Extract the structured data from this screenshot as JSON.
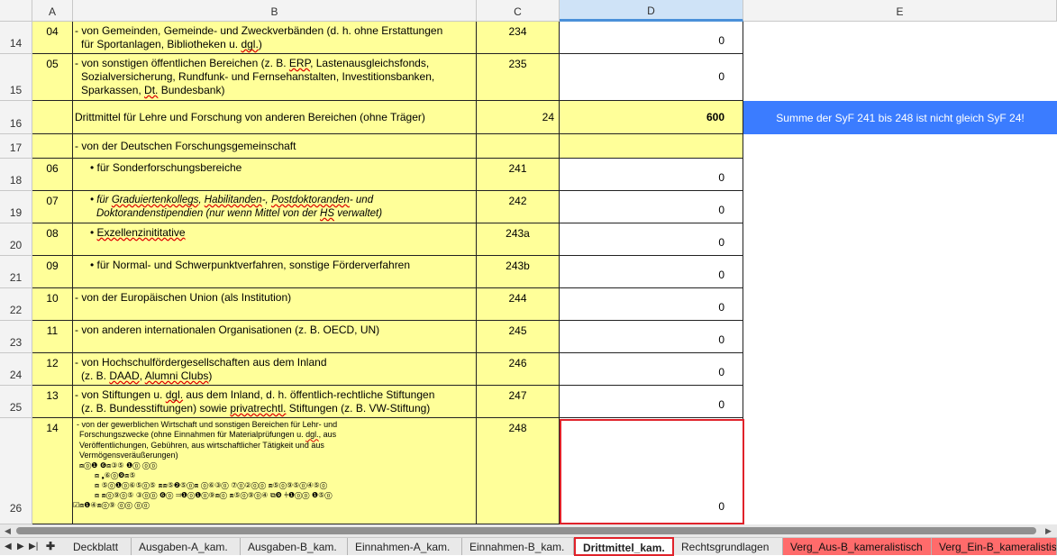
{
  "columns": [
    "A",
    "B",
    "C",
    "D",
    "E"
  ],
  "rows": {
    "r14": {
      "num": "14",
      "a": "04",
      "b1": "- von Gemeinden, Gemeinde- und Zweckverbänden (d. h. ohne Erstattungen",
      "b2": "für Sportanlagen, Bibliotheken u. ",
      "b2w": "dgl.",
      "b2e": ")",
      "c": "234",
      "d": "0"
    },
    "r15": {
      "num": "15",
      "a": "05",
      "b1a": "- von sonstigen öffentlichen Bereichen (z. B. ",
      "b1w": "ERP",
      "b1b": ", Lastenausgleichsfonds,",
      "b2": "Sozialversicherung, Rundfunk- und Fernsehanstalten, Investitionsbanken,",
      "b3a": "Sparkassen, ",
      "b3w": "Dt.",
      "b3b": " Bundesbank)",
      "c": "235",
      "d": "0"
    },
    "r16": {
      "num": "16",
      "a": "",
      "b": "Drittmittel für Lehre und Forschung von anderen Bereichen (ohne Träger)",
      "c": "24",
      "d": "600",
      "e": "Summe der SyF 241 bis 248 ist nicht gleich SyF 24!"
    },
    "r17": {
      "num": "17",
      "a": "",
      "b": "- von der Deutschen Forschungsgemeinschaft",
      "c": "",
      "d": ""
    },
    "r18": {
      "num": "18",
      "a": "06",
      "b": "• für Sonderforschungsbereiche",
      "c": "241",
      "d": "0"
    },
    "r19": {
      "num": "19",
      "a": "07",
      "b1a": "• für ",
      "b1w1": "Graduiertenkollegs",
      "b1b": ", ",
      "b1w2": "Habilitanden",
      "b1c": "-, ",
      "b1w3": "Postdoktoranden",
      "b1d": "- und",
      "b2a": "Doktorandenstipendien (nur wenn Mittel von der ",
      "b2w": "HS",
      "b2b": " verwaltet)",
      "c": "242",
      "d": "0"
    },
    "r20": {
      "num": "20",
      "a": "08",
      "b0": "• ",
      "bw": "Exzellenzinititative",
      "c": "243a",
      "d": "0"
    },
    "r21": {
      "num": "21",
      "a": "09",
      "b": "• für Normal- und Schwerpunktverfahren, sonstige Förderverfahren",
      "c": "243b",
      "d": "0"
    },
    "r22": {
      "num": "22",
      "a": "10",
      "b": "- von der Europäischen Union (als Institution)",
      "c": "244",
      "d": "0"
    },
    "r23": {
      "num": "23",
      "a": "11",
      "b": "- von anderen internationalen Organisationen (z. B. OECD, UN)",
      "c": "245",
      "d": "0"
    },
    "r24": {
      "num": "24",
      "a": "12",
      "b1": "- von Hochschulfördergesellschaften aus dem Inland",
      "b2a": "(z. B. ",
      "b2w1": "DAAD",
      "b2b": ", ",
      "b2w2": "Alumni Clubs",
      "b2c": ")",
      "c": "246",
      "d": "0"
    },
    "r25": {
      "num": "25",
      "a": "13",
      "b1a": "- von Stiftungen u. ",
      "b1w": "dgl.",
      "b1b": " aus dem Inland, d. h. öffentlich-rechtliche Stiftungen",
      "b2a": "(z. B. Bundesstiftungen) sowie ",
      "b2w": "privatrechtl.",
      "b2b": " Stiftungen (z. B. VW-Stiftung)",
      "c": "247",
      "d": "0"
    },
    "r26": {
      "num": "26",
      "a": "14",
      "b1": "- von der gewerblichen Wirtschaft und sonstigen  Bereichen für Lehr- und",
      "b2a": "Forschungszwecke (ohne Einnahmen für Materialprüfungen u. ",
      "b2w": "dgl.",
      "b2b": ", aus",
      "b3": "Veröffentlichungen, Gebühren, aus wirtschaftlicher Tätigkeit und aus",
      "b4": "Vermögensveräußerungen)",
      "g1": "⧈⓪❶ ❻⧈③⑤ ❶⓪ ⓪⓪",
      "g2": "⧈  ❟⑥⓪❾⧈⑤",
      "g3": "⧈ ⑤⓪❶⓪⑥⑤⓪⑤ ⧈⧈⑤❷⑤⓪⧈  ⓪⑥③⓪  ⑦⓪②⓪⓪ ⧈⑤⓪⑨⑤⓪④⑤⓪",
      "g4": "⧈ ⧈⓪⑨⓪⑤ ③⓪⓪ ❻⓪ ⫤❶⓪❶⓪⑨⧈⓪ ⧈⑤⓪⑨⓪④ ⧉❾ ⫩❶⓪⓪ ❶⑤⓪",
      "g5": "☑⧈❶④⧈⓪⑨  ⓪⓪ ⓪⓪",
      "c": "248",
      "d": "0"
    }
  },
  "sheet_tabs": [
    "Deckblatt",
    "Ausgaben-A_kam.",
    "Ausgaben-B_kam.",
    "Einnahmen-A_kam.",
    "Einnahmen-B_kam.",
    "Drittmittel_kam.",
    "Rechtsgrundlagen",
    "Verg_Aus-B_kameralistisch",
    "Verg_Ein-B_kameralistisch"
  ],
  "nav": {
    "first": "◀",
    "prev": "▶",
    "next": "▶|",
    "add": "✚"
  },
  "colors": {
    "yellow": "#ffff99",
    "warning_blue": "#3b7cff",
    "highlight_red": "#e0222a",
    "tab_red": "#ff6b6b"
  }
}
